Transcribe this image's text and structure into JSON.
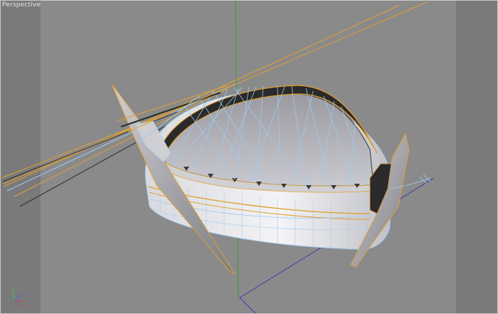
{
  "viewport": {
    "label": "Perspective",
    "background_color": "#7a7a7a",
    "safe_frame_color": "#8a8a8a",
    "frame_color": "#c8c8c8"
  },
  "scene": {
    "object": "boat-hull-wireframe",
    "wire_color_selected": "#e0a030",
    "wire_color_edges": "#9ecbf2",
    "hull_shade_light": "#e8e8ec",
    "hull_shade_dark": "#6a6a70"
  },
  "axis_gizmo": {
    "x_label": "x",
    "y_label": "y",
    "z_label": "z",
    "x_color": "#d04040",
    "y_color": "#40c040",
    "z_color": "#4060e0"
  },
  "grid_axes": {
    "vertical_color": "#3a9a3a",
    "horizontal_color": "#3a3ab0"
  }
}
